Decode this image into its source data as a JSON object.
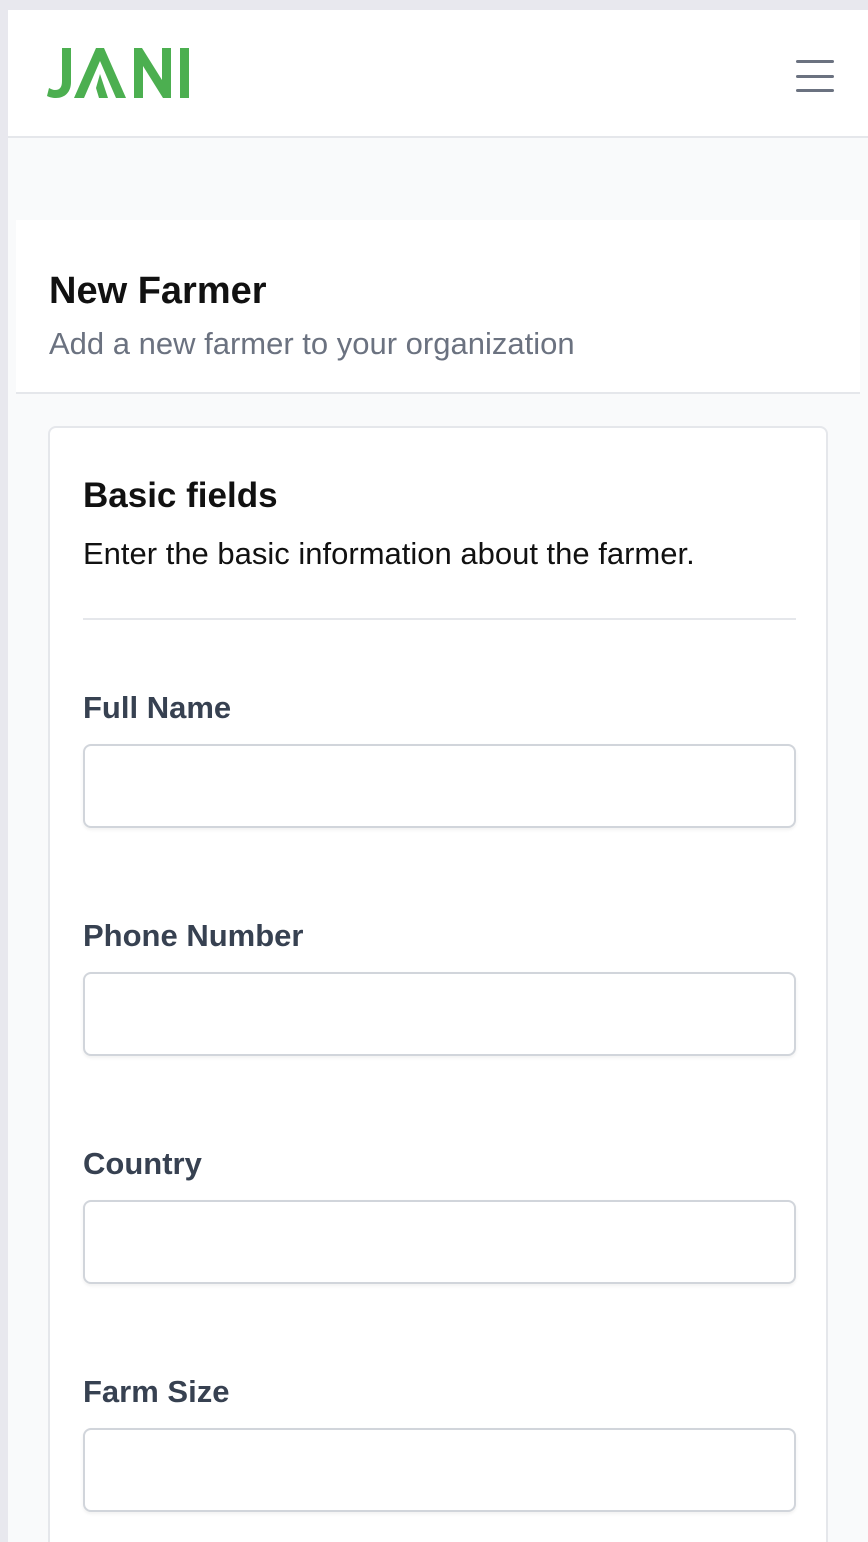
{
  "header": {
    "logo_text": "JANI",
    "menu_icon": "hamburger-menu-icon",
    "brand_color": "#4caf50"
  },
  "page": {
    "title": "New Farmer",
    "subtitle": "Add a new farmer to your organization"
  },
  "form": {
    "section_title": "Basic fields",
    "section_description": "Enter the basic information about the farmer.",
    "fields": [
      {
        "label": "Full Name",
        "value": ""
      },
      {
        "label": "Phone Number",
        "value": ""
      },
      {
        "label": "Country",
        "value": ""
      },
      {
        "label": "Farm Size",
        "value": ""
      }
    ]
  }
}
